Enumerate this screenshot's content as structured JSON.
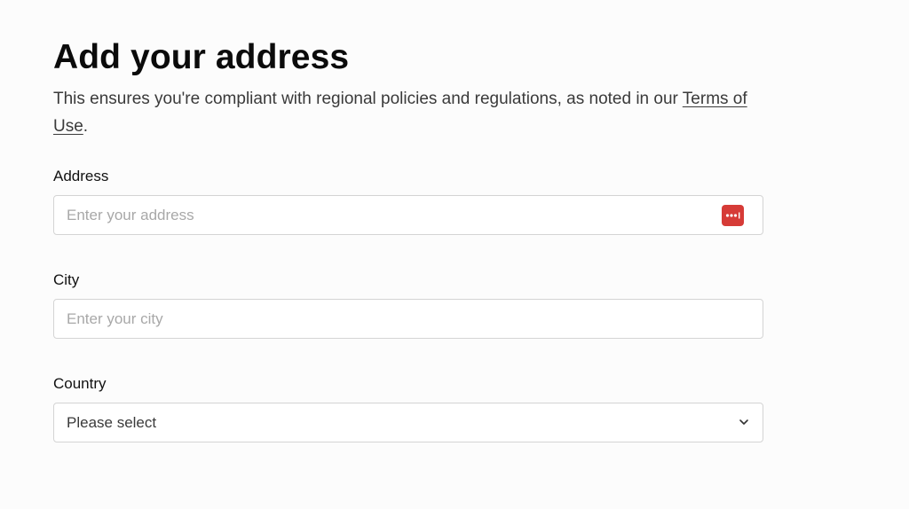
{
  "header": {
    "title": "Add your address",
    "subtitle_text": "This ensures you're compliant with regional policies and regulations, as noted in our",
    "terms_link": "Terms of Use",
    "subtitle_end": "."
  },
  "form": {
    "address": {
      "label": "Address",
      "placeholder": "Enter your address",
      "value": "",
      "icon": "password-manager-icon",
      "icon_color": "#d63b37"
    },
    "city": {
      "label": "City",
      "placeholder": "Enter your city",
      "value": ""
    },
    "country": {
      "label": "Country",
      "selected": "Please select",
      "icon": "chevron-down-icon"
    }
  }
}
